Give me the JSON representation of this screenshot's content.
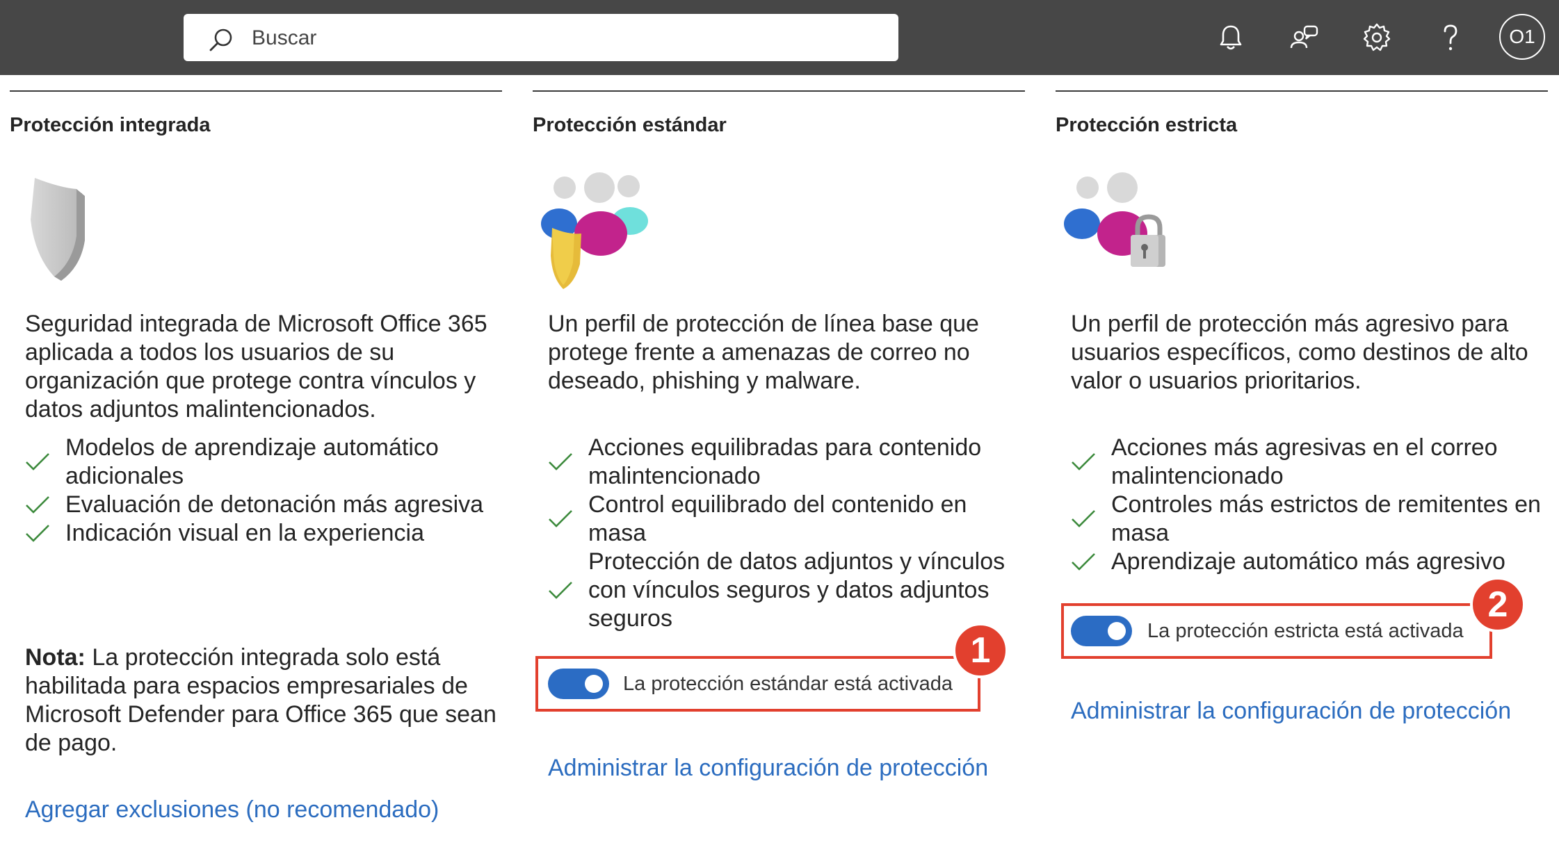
{
  "search": {
    "placeholder": "Buscar"
  },
  "header": {
    "avatar_initials": "O1"
  },
  "columns": [
    {
      "title": "Protección integrada",
      "description": "Seguridad integrada de Microsoft Office 365 aplicada a todos los usuarios de su organización que protege contra vínculos y datos adjuntos malintencionados.",
      "features": [
        "Modelos de aprendizaje automático adicionales",
        "Evaluación de detonación más agresiva",
        "Indicación visual en la experiencia"
      ],
      "note_label": "Nota:",
      "note_text": " La protección integrada solo está habilitada para espacios empresariales de Microsoft Defender para Office 365 que sean de pago.",
      "link": "Agregar exclusiones (no recomendado)"
    },
    {
      "title": "Protección estándar",
      "description": "Un perfil de protección de línea base que protege frente a amenazas de correo no deseado, phishing y malware.",
      "features": [
        "Acciones equilibradas para contenido malintencionado",
        "Control equilibrado del contenido en masa",
        "Protección de datos adjuntos y vínculos con vínculos seguros y datos adjuntos seguros"
      ],
      "toggle_label": "La protección estándar está activada",
      "toggle_on": true,
      "badge": "1",
      "link": "Administrar la configuración de protección"
    },
    {
      "title": "Protección estricta",
      "description": "Un perfil de protección más agresivo para usuarios específicos, como destinos de alto valor o usuarios prioritarios.",
      "features": [
        "Acciones más agresivas en el correo malintencionado",
        "Controles más estrictos de remitentes en masa",
        "Aprendizaje automático más agresivo"
      ],
      "toggle_label": "La protección estricta está activada",
      "toggle_on": true,
      "badge": "2",
      "link": "Administrar la configuración de protección"
    }
  ],
  "icons": {
    "topbar": [
      "search-icon",
      "bell-icon",
      "feedback-icon",
      "gear-icon",
      "help-icon"
    ],
    "illustrations": [
      "shield-illustration",
      "users-shield-illustration",
      "users-lock-illustration"
    ],
    "checkmark": "checkmark-icon"
  },
  "colors": {
    "topbar": "#474747",
    "link": "#2b6cbf",
    "toggle_on": "#2b6cc4",
    "highlight": "#e2402e",
    "checkmark": "#3c8a3c"
  }
}
